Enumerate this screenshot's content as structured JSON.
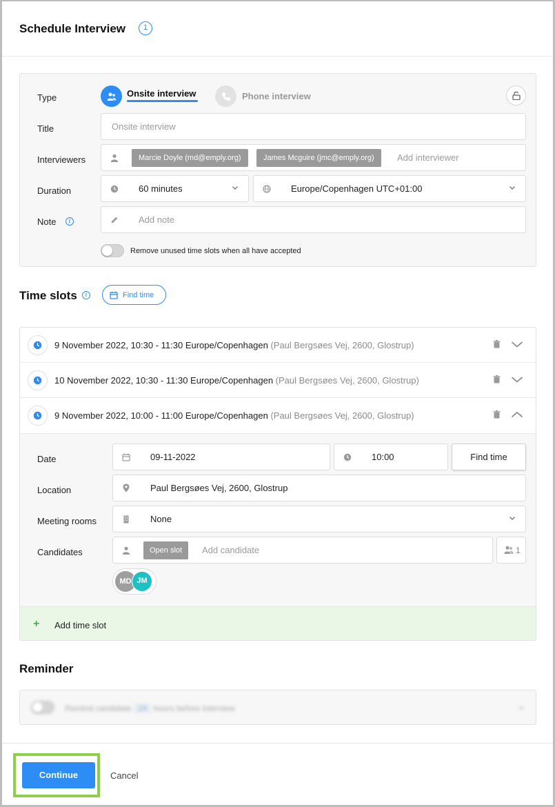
{
  "header": {
    "title": "Schedule Interview",
    "step": "1"
  },
  "form": {
    "type_label": "Type",
    "type_options": [
      {
        "label": "Onsite interview",
        "selected": true
      },
      {
        "label": "Phone interview",
        "selected": false
      }
    ],
    "title_label": "Title",
    "title_placeholder": "Onsite interview",
    "interviewers_label": "Interviewers",
    "interviewers": [
      "Marcie Doyle (md@emply.org)",
      "James Mcguire (jmc@emply.org)"
    ],
    "interviewer_placeholder": "Add interviewer",
    "duration_label": "Duration",
    "duration_value": "60 minutes",
    "timezone_value": "Europe/Copenhagen UTC+01:00",
    "note_label": "Note",
    "note_placeholder": "Add note",
    "remove_unused_label": "Remove unused time slots when all have accepted"
  },
  "time_slots": {
    "title": "Time slots",
    "find_time_label": "Find time",
    "slots": [
      {
        "when": "9 November 2022, 10:30 - 11:30 Europe/Copenhagen",
        "location": "(Paul Bergsøes Vej, 2600, Glostrup)",
        "expanded": false
      },
      {
        "when": "10 November 2022, 10:30 - 11:30 Europe/Copenhagen",
        "location": "(Paul Bergsøes Vej, 2600, Glostrup)",
        "expanded": false
      },
      {
        "when": "9 November 2022, 10:00 - 11:00 Europe/Copenhagen",
        "location": "(Paul Bergsøes Vej, 2600, Glostrup)",
        "expanded": true
      }
    ],
    "detail": {
      "date_label": "Date",
      "date_value": "09-11-2022",
      "time_value": "10:00",
      "find_time_button": "Find time",
      "location_label": "Location",
      "location_value": "Paul Bergsøes Vej, 2600, Glostrup",
      "rooms_label": "Meeting rooms",
      "rooms_value": "None",
      "candidates_label": "Candidates",
      "open_slot_tag": "Open slot",
      "candidate_placeholder": "Add candidate",
      "candidate_count": "1",
      "avatars": [
        "MD",
        "JM"
      ]
    },
    "add_slot_label": "Add time slot"
  },
  "reminder": {
    "title": "Reminder",
    "text_before": "Remind candidate",
    "hours": "24",
    "text_after": "hours before interview"
  },
  "footer": {
    "continue_label": "Continue",
    "cancel_label": "Cancel"
  },
  "colors": {
    "accent": "#2d8df5",
    "highlight": "#8cd04a",
    "add_slot_bg": "#eaf6e6",
    "avatar_md": "#9e9e9e",
    "avatar_jm": "#1fc0c4"
  }
}
